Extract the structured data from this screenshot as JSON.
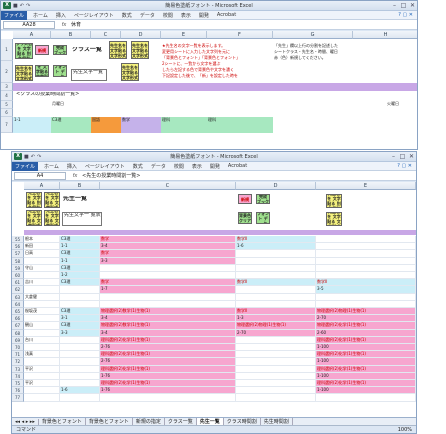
{
  "back": {
    "title": "簡易色塗紙フォント - Microsoft Excel",
    "ribbon": [
      "ファイル",
      "ホーム",
      "挿入",
      "ページレイアウト",
      "数式",
      "データ",
      "校閲",
      "表示",
      "開発",
      "Acrobat"
    ],
    "name_box": "AA28",
    "formula": "休育",
    "cols": [
      "A",
      "B",
      "C",
      "D",
      "E",
      "F",
      "G",
      "H"
    ],
    "buttons": {
      "class_kind": "クラス名を\n文字貼る\n別名保存",
      "newbook": "新規",
      "kansei": "完成\nブック",
      "class_list": "クラス一覧",
      "teacher_list": "先生名を\n文字貼る\n文字形式",
      "chouhyou": "先生名を\n文字貼る\n文字形式",
      "font": "フォント\nデータ",
      "teacher_list_btn": "先生文字一覧",
      "sen_ichiran": "先生名を\n文字貼る\n文字形式",
      "aux1": "先生名を\n文字貼る\n文字形式",
      "aux2": "先生名を\n文字貼る\n文字形式"
    },
    "notes": [
      "★先生名の文字一覧を表示します。",
      "「先生」欄以上行の分割を記述した",
      "変更用シートに入力した文字列を元に",
      "「背景色とフォント」「背景色とフォント」",
      "2シートに、一覧から文字を選ぶ",
      "したら左記する色で背景色や文字を濃く",
      "すると作成",
      "する新規",
      "「新規の用紙」",
      "シートクラス・先生名・時間、曜日",
      "下記設定した後で、「新」を設定した時を",
      "赤（色）新規してください。"
    ],
    "row_banner": "<クラスの授業時間割一覧>",
    "weekday": "月曜日",
    "weekday2": "火曜日",
    "row_num": "1-1",
    "cells": [
      "C3理",
      "国語",
      "数学",
      "理科",
      "理科",
      "5",
      "6",
      "1"
    ]
  },
  "front": {
    "title": "簡易色塗紙フォント - Microsoft Excel",
    "ribbon": [
      "ファイル",
      "ホーム",
      "挿入",
      "ページレイアウト",
      "数式",
      "データ",
      "校閲",
      "表示",
      "開発",
      "Acrobat"
    ],
    "name_box": "A4",
    "formula": "<先生の授業時間割一覧>",
    "cols": [
      "A",
      "B",
      "C",
      "D",
      "E"
    ],
    "buttons": {
      "b1": "先生名を\n文字貼る\n別名保存",
      "b2": "先生名を\n文字貼る\n文字形式",
      "b3": "先生名を\n文字貼る\n文字形式",
      "b4": "先生名を\n文字貼る\n文字形式",
      "list": "先生一覧",
      "newbook": "新規",
      "kansei": "完成\nブック",
      "seikaku": "背景色\nクリア",
      "font": "フォント\nデータ",
      "big1": "先生名を\n文字貼る\n別名保存",
      "big2": "先生名を\n文字貼る\n文字形式",
      "teacher_list_btn": "先生文字一\n覧表"
    },
    "row_nums": [
      "1",
      "2",
      "3",
      "55",
      "56",
      "57",
      "58",
      "59",
      "60",
      "61",
      "62",
      "63",
      "64",
      "65",
      "66",
      "67",
      "68",
      "69",
      "70",
      "71",
      "72",
      "73",
      "74",
      "75",
      "76",
      "77"
    ],
    "teachers": [
      "",
      "",
      "",
      "根本",
      "新田",
      "日高",
      "",
      "守山",
      "",
      "吉川",
      "",
      "大倉健",
      "",
      "桜坂茂",
      "",
      "観山",
      "",
      "台川",
      "",
      "浅真",
      "",
      "平沢",
      "",
      "平沢",
      "",
      ""
    ],
    "col_b": [
      "",
      "",
      "",
      "C3理",
      "1-1",
      "C3理",
      "1-1",
      "C3理",
      "1-2",
      "C3理",
      "",
      "",
      "",
      "C3理",
      "3-1",
      "C3理",
      "3-3",
      "",
      "",
      "",
      "",
      "",
      "",
      "",
      "1-6",
      ""
    ],
    "col_c": [
      "",
      "",
      "",
      "数学",
      "3-4",
      "数学",
      "3-3",
      "",
      "",
      "数学",
      "1-7",
      "",
      "",
      "物理選択(2)数学(1)生物(1)",
      "3-4",
      "物理選択(2)数学(1)生物(1)",
      "3-4",
      "理科選択(2)化学(1)生物(1)",
      "2-76",
      "理科選択(2)化学(1)生物(1)",
      "2-76",
      "理科選択(2)化学(1)生物(1)",
      "1-76",
      "理科選択(2)化学(1)生物(1)",
      "1-76",
      ""
    ],
    "col_d": [
      "",
      "",
      "",
      "数学II",
      "1-6",
      "",
      "",
      "",
      "",
      "数学II",
      "",
      "",
      "",
      "数学II",
      "1-3",
      "物理選択(2)物理(1)生物(1)",
      "2-70",
      "",
      "",
      "",
      "",
      "",
      "",
      "",
      "",
      ""
    ],
    "col_e": [
      "",
      "",
      "",
      "",
      "",
      "",
      "",
      "",
      "",
      "数学II",
      "3-5",
      "",
      "",
      "物理選択(2)物理(1)生物(1)",
      "2-70",
      "物理選択(2)化学(1)生物(1)",
      "2-60",
      "理科選択(2)化学(1)生物(1)",
      "1-100",
      "理科選択(2)化学(1)生物(1)",
      "1-100",
      "理科選択(2)化学(1)生物(1)",
      "1-100",
      "理科選択(2)化学(1)生物(1)",
      "1-100",
      ""
    ],
    "tabs": [
      "背景色とフォント",
      "背景色とフォント",
      "新規の指定",
      "クラス一覧",
      "先生一覧",
      "クラス時間割",
      "先生時間割"
    ],
    "active_tab": "先生一覧",
    "status_left": "コマンド",
    "zoom": "100%"
  }
}
